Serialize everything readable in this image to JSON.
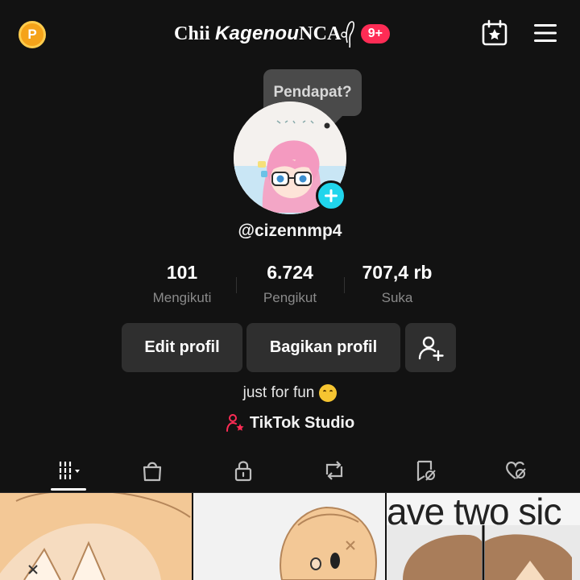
{
  "header": {
    "coin_label": "P",
    "title_plain_prefix": "Chii ",
    "title_italic": "Kagenou",
    "title_plain_suffix": "NCA",
    "notification_badge": "9+",
    "icons": [
      "coin-icon",
      "calendar-star-icon",
      "hamburger-menu-icon"
    ]
  },
  "profile": {
    "tooltip": "Pendapat?",
    "username": "@cizennmp4",
    "bio": "just for fun",
    "studio_label": "TikTok Studio"
  },
  "stats": [
    {
      "value": "101",
      "label": "Mengikuti"
    },
    {
      "value": "6.724",
      "label": "Pengikut"
    },
    {
      "value": "707,4 rb",
      "label": "Suka"
    }
  ],
  "actions": {
    "edit_profile": "Edit profil",
    "share_profile": "Bagikan profil"
  },
  "tabs": [
    "videos-grid-icon",
    "shop-bag-icon",
    "lock-icon",
    "repost-icon",
    "favorites-icon",
    "liked-icon"
  ],
  "grid": {
    "thumb3_text": "ave two sic"
  },
  "colors": {
    "background": "#121212",
    "button": "#2f2f2f",
    "badge": "#fe2c55",
    "accent_cyan": "#20d5ec",
    "coin": "#f5a31a"
  }
}
